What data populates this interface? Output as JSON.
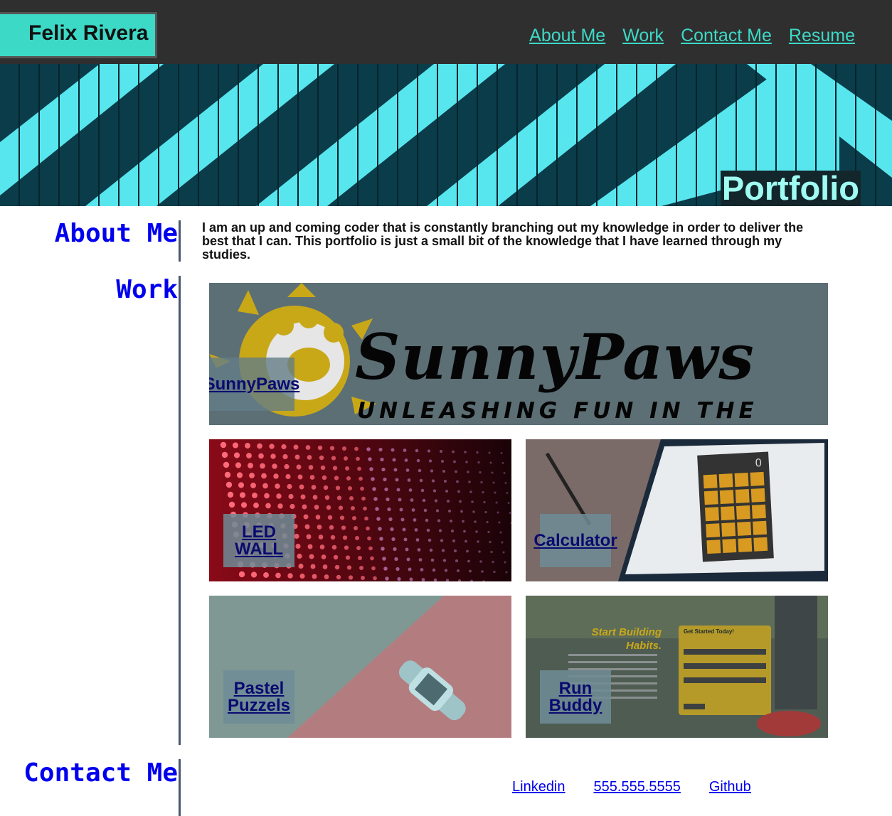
{
  "header": {
    "name": "Felix Rivera",
    "nav": [
      "About Me",
      "Work",
      "Contact Me",
      "Resume"
    ]
  },
  "hero": {
    "title": "Portfolio"
  },
  "about": {
    "heading": "About Me",
    "text": "I am an up and coming coder that is constantly branching out my knowledge in order to deliver the best that I can. This portfolio is just a small bit of the knowledge that I have learned through my studies."
  },
  "work": {
    "heading": "Work",
    "projects": [
      {
        "label": "SunnyPaws",
        "banner_title": "SunnyPaws",
        "banner_tagline": "UNLEASHING FUN IN THE SUN"
      },
      {
        "label": "LED WALL"
      },
      {
        "label": "Calculator",
        "display": "0"
      },
      {
        "label": "Pastel Puzzels"
      },
      {
        "label": "Run Buddy",
        "banner_title_1": "Start Building",
        "banner_title_2": "Habits.",
        "form_title": "Get Started Today!"
      }
    ]
  },
  "contact": {
    "heading": "Contact Me",
    "links": [
      "Linkedin",
      "555.555.5555",
      "Github"
    ]
  },
  "colors": {
    "header_bg": "#2f2f2f",
    "accent": "#3dd9c7",
    "link": "#0000ee"
  }
}
